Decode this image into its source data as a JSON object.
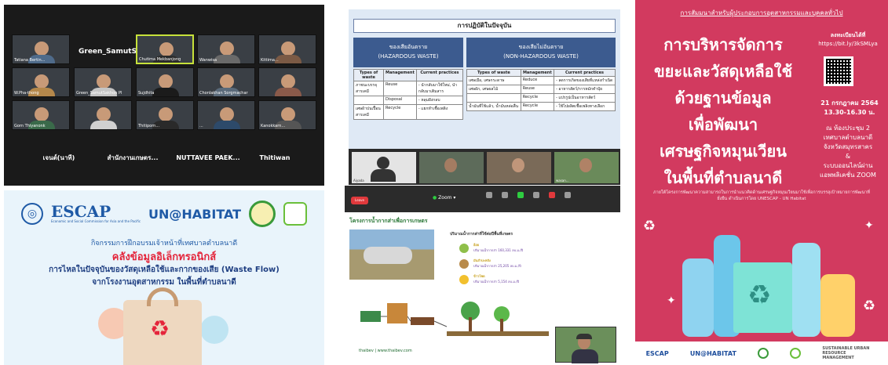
{
  "panel_zoom_gallery": {
    "featured_name": "Green_SamutSak...",
    "tiles": [
      {
        "name": "Tatiana Bertin..."
      },
      {
        "name": ""
      },
      {
        "name": "Chutima Mekbanjong"
      },
      {
        "name": "Wanwisa"
      },
      {
        "name": "Kittima..."
      },
      {
        "name": "W.Pha-thong"
      },
      {
        "name": "Green_SamutSakhon Pl"
      },
      {
        "name": "Sujdhita"
      },
      {
        "name": "Chonlakhan Sorgmachar"
      },
      {
        "name": ""
      },
      {
        "name": "Gorn Thiyanonk"
      },
      {
        "name": ""
      },
      {
        "name": "Thitiporn..."
      },
      {
        "name": "..."
      },
      {
        "name": "Kanokkarn..."
      }
    ],
    "name_tiles": [
      {
        "label": "เจนต์(นาที)"
      },
      {
        "label": "สำนักงานเกษตร..."
      },
      {
        "label": "NUTTAVEE PAEK..."
      },
      {
        "label": "Thitiwan"
      }
    ]
  },
  "panel_slide_table": {
    "title": "การปฏิบัติในปัจจุบัน",
    "hazardous_header_th": "ของเสียอันตราย",
    "hazardous_header_en": "(HAZARDOUS WASTE)",
    "non_hazardous_header_th": "ของเสียไม่อันตราย",
    "non_hazardous_header_en": "(NON-HAZARDOUS WASTE)",
    "col_type": "Types of waste",
    "col_management": "Management",
    "col_practices": "Current practices",
    "haz_rows": [
      {
        "type": "ภาชนะบรรจุสารเคมี",
        "management": "Reuse",
        "practice": "- นำกลับมาใช้ใหม่, นำกลับมาเติมสาร"
      },
      {
        "type": "",
        "management": "Disposal",
        "practice": "- หลุมฝังกลบ"
      },
      {
        "type": "เศษผ้าปนเปื้อนสารเคมี",
        "management": "Recycle",
        "practice": "- แยกทำเชื้อเพลิง"
      }
    ],
    "nonhaz_rows": [
      {
        "type": "เศษเมือ, เศษกระดาษ",
        "management": "Reduce",
        "practice": "- ลดการเกิดของเสียที่แหล่งกำเนิด"
      },
      {
        "type": "เศษผัก, เศษผลไม้",
        "management": "Reuse",
        "practice": "- อาหารสัตว์/การหมักทำปุ๋ย"
      },
      {
        "type": "",
        "management": "Recycle",
        "practice": "- แปรรูปเป็นอาหารสัตว์"
      },
      {
        "type": "น้ำมันที่ใช้แล้ว, น้ำมันหล่อลื่น",
        "management": "Recycle",
        "practice": "- ใช้ไปผลิตเชื้อเพลิงทางเลือก"
      }
    ],
    "video_labels": [
      "Aiyada",
      "",
      "",
      "wasan..."
    ]
  },
  "panel_poster": {
    "top_line": "การสัมมนาสำหรับผู้ประกอบการอุตสาหกรรมและบุคคลทั่วไป",
    "headline_1": "การบริหารจัดการ",
    "headline_2": "ขยะและวัสดุเหลือใช้",
    "headline_3": "ด้วยฐานข้อมูล",
    "headline_4": "เพื่อพัฒนา",
    "headline_5": "เศรษฐกิจหมุนเวียน",
    "headline_6": "ในพื้นที่ตำบลนาดี",
    "register_label": "ลงทะเบียนได้ที่",
    "register_url": "https://bit.ly/3kSMLya",
    "date_line": "21 กรกฎาคม 2564",
    "time_line": "13.30-16.30 น.",
    "place_1": "ณ ห้องประชุม 2",
    "place_2": "เทศบาลตำบลนาดี",
    "place_3": "จังหวัดสมุทรสาคร",
    "place_amp": "&",
    "place_4": "ระบบออนไลน์ผ่าน",
    "place_5": "แอพพลิเคชั่น ZOOM",
    "fine_print": "ภายใต้โครงการพัฒนาความสามารถในการนำแนวคิดด้านเศรษฐกิจหมุนเวียนมาใช้เพื่อการบรรลุเป้าหมายการพัฒนาที่ยั่งยืน ดำเนินการโดย UNESCAP - UN Habitat",
    "footer_escap": "ESCAP",
    "footer_unh": "UN@HABITAT",
    "footer_surm": "SUSTAINABLE URBAN RESOURCE MANAGEMENT"
  },
  "panel_escap_banner": {
    "escap_wordmark": "ESCAP",
    "escap_sub": "Economic and Social Commission for Asia and the Pacific",
    "unhabitat_wordmark": "UN@HABITAT",
    "line1": "กิจกรรมการฝึกอบรมเจ้าหน้าที่เทศบาลตำบลนาดี",
    "line2": "คลังข้อมูลอิเล็กทรอนิกส์",
    "line3": "การไหลในปัจจุบันของวัสดุเหลือใช้และกากของเสีย (Waste Flow)",
    "line4": "จากโรงงานอุตสาหกรรม ในพื้นที่ตำบลนาดี"
  },
  "panel_zoom_mobile": {
    "leave_label": "Leave",
    "zoom_label": "Zoom",
    "slide_title": "โครงการน้ำกากส่าเพื่อการเกษตร",
    "info_title": "ปริมาณน้ำกากส่าที่ใช้ต่อปีพื้นที่เกษตร",
    "rows": [
      {
        "crop": "อ้อย",
        "value": "ปริมาณน้ำกากส่า 160,331 ลบ.ม./ปี"
      },
      {
        "crop": "มันสำปะหลัง",
        "value": "ปริมาณน้ำกากส่า 25,205 ลบ.ม./ปี"
      },
      {
        "crop": "ข้าวโพด",
        "value": "ปริมาณน้ำกากส่า 5,154 ลบ.ม./ปี"
      }
    ],
    "footer_brand": "thaibev | www.thaibev.com",
    "colors": {
      "leave": "#e0393c",
      "zoom_dot": "#2ecc40"
    }
  }
}
